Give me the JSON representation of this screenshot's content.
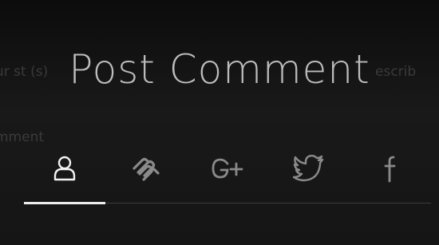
{
  "background": {
    "ghost_left": "ur st (s)",
    "ghost_right": "escrib",
    "ghost_comment": "mment"
  },
  "dialog": {
    "title": "Post Comment",
    "tabs": [
      {
        "id": "anonymous",
        "icon": "user-icon",
        "active": true
      },
      {
        "id": "squarespace",
        "icon": "squarespace-icon",
        "active": false
      },
      {
        "id": "google-plus",
        "icon": "google-plus-icon",
        "label": "G+",
        "active": false
      },
      {
        "id": "twitter",
        "icon": "twitter-icon",
        "active": false
      },
      {
        "id": "facebook",
        "icon": "facebook-icon",
        "label": "f",
        "active": false
      }
    ]
  },
  "colors": {
    "active_icon": "#f2f2f2",
    "inactive_icon": "#8a8a8a",
    "title": "#bdbdbd"
  }
}
